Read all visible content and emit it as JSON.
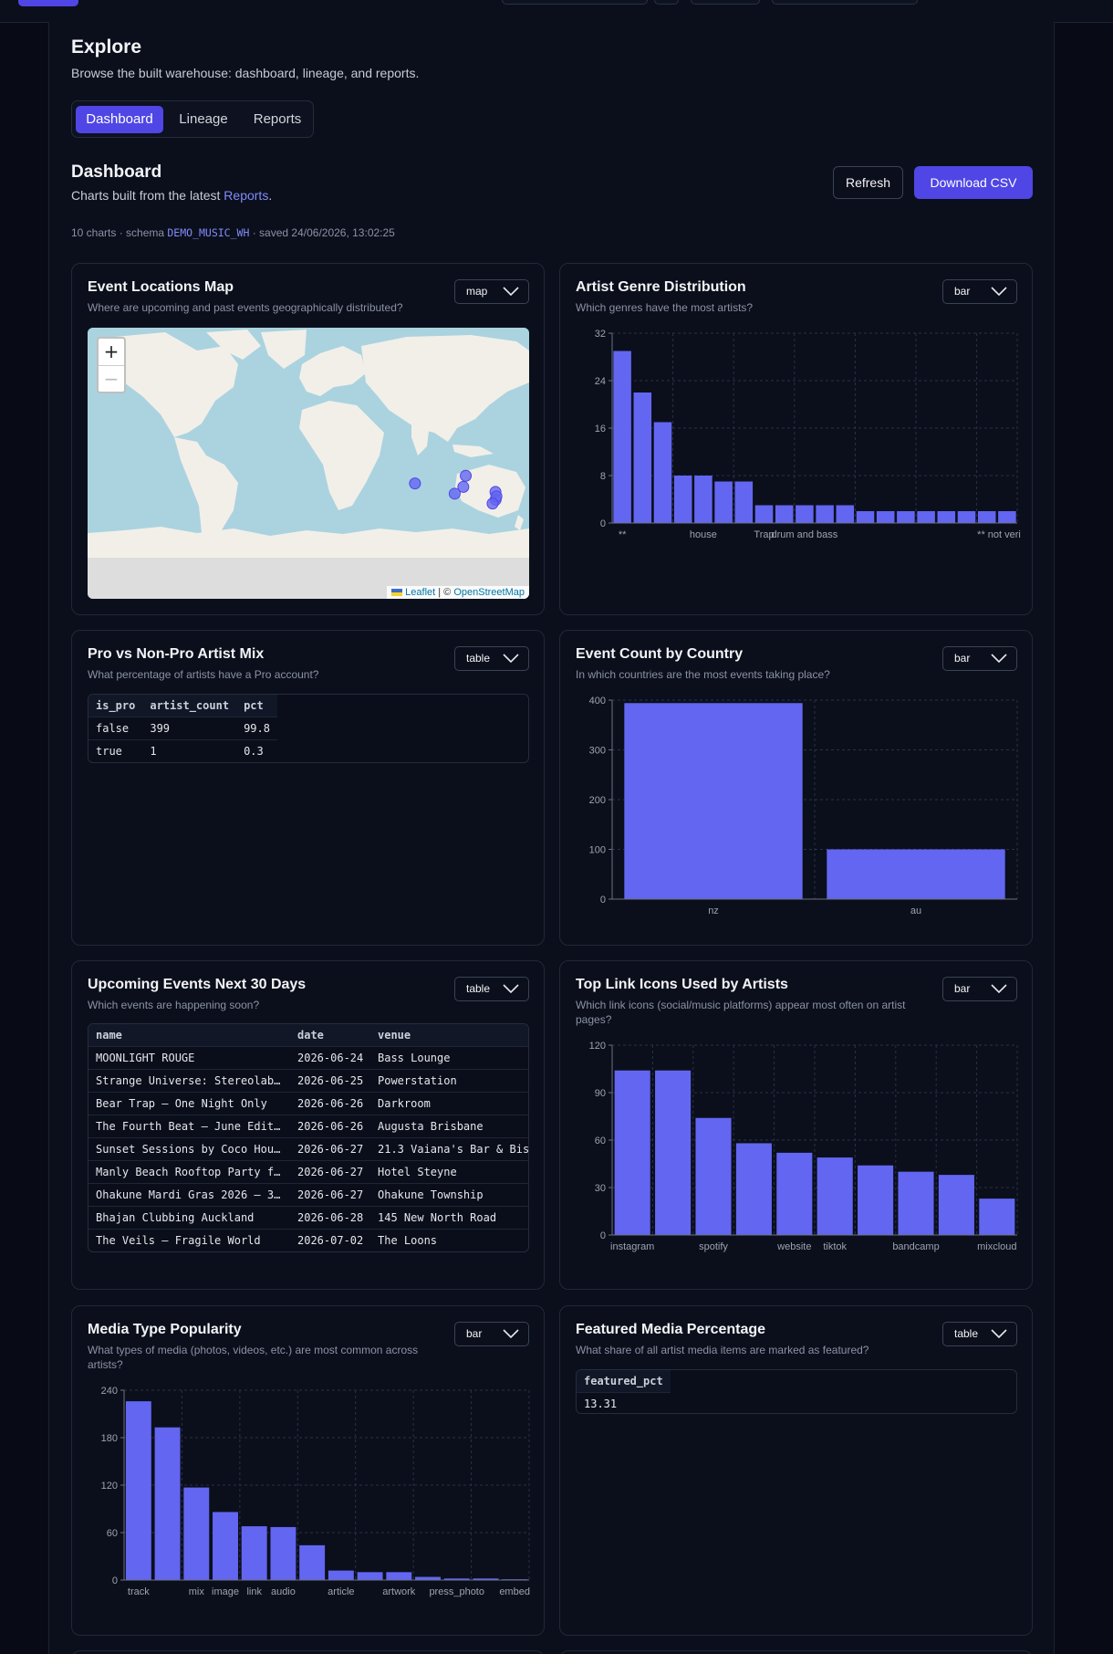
{
  "page": {
    "title": "Explore",
    "subtitle": "Browse the built warehouse: dashboard, lineage, and reports.",
    "tabs": [
      "Dashboard",
      "Lineage",
      "Reports"
    ],
    "active_tab": "Dashboard"
  },
  "dashboard": {
    "title": "Dashboard",
    "subtitle_prefix": "Charts built from the latest ",
    "subtitle_link": "Reports",
    "subtitle_suffix": ".",
    "refresh_label": "Refresh",
    "download_label": "Download CSV",
    "meta_prefix": "10 charts · schema ",
    "schema": "DEMO_MUSIC_WH",
    "meta_suffix": " · saved 24/06/2026, 13:02:25"
  },
  "cards": {
    "map": {
      "title": "Event Locations Map",
      "question": "Where are upcoming and past events geographically distributed?",
      "view": "map",
      "zoom_in": "+",
      "zoom_out": "−",
      "attribution_leaflet": "Leaflet",
      "attribution_sep": " | © ",
      "attribution_osm": "OpenStreetMap",
      "points": [
        {
          "lat": -17.5,
          "lng": -149.5
        },
        {
          "lat": -27.5,
          "lng": 153.0
        },
        {
          "lat": -33.9,
          "lng": 151.2
        },
        {
          "lat": -37.8,
          "lng": 144.9
        },
        {
          "lat": -36.8,
          "lng": 174.7
        },
        {
          "lat": -41.3,
          "lng": 174.8
        },
        {
          "lat": -39.4,
          "lng": 175.4
        },
        {
          "lat": -43.5,
          "lng": 172.6
        },
        {
          "lat": -31.9,
          "lng": 115.9
        }
      ]
    },
    "genre": {
      "title": "Artist Genre Distribution",
      "question": "Which genres have the most artists?",
      "view": "bar"
    },
    "pro": {
      "title": "Pro vs Non-Pro Artist Mix",
      "question": "What percentage of artists have a Pro account?",
      "view": "table",
      "columns": [
        "is_pro",
        "artist_count",
        "pct"
      ],
      "rows": [
        [
          "false",
          "399",
          "99.8"
        ],
        [
          "true",
          "1",
          "0.3"
        ]
      ]
    },
    "country": {
      "title": "Event Count by Country",
      "question": "In which countries are the most events taking place?",
      "view": "bar"
    },
    "upcoming": {
      "title": "Upcoming Events Next 30 Days",
      "question": "Which events are happening soon?",
      "view": "table",
      "columns": [
        "name",
        "date",
        "venue"
      ],
      "rows": [
        [
          "MOONLIGHT ROUGE",
          "2026-06-24",
          "Bass Lounge"
        ],
        [
          "Strange Universe: Stereolab…",
          "2026-06-25",
          "Powerstation"
        ],
        [
          "Bear Trap – One Night Only",
          "2026-06-26",
          "Darkroom"
        ],
        [
          "The Fourth Beat – June Edit…",
          "2026-06-26",
          "Augusta Brisbane"
        ],
        [
          "Sunset Sessions by Coco Hou…",
          "2026-06-27",
          "21.3 Vaiana's Bar & Bis"
        ],
        [
          "Manly Beach Rooftop Party f…",
          "2026-06-27",
          "Hotel Steyne"
        ],
        [
          "Ohakune Mardi Gras 2026 – 3…",
          "2026-06-27",
          "Ohakune Township"
        ],
        [
          "Bhajan Clubbing Auckland",
          "2026-06-28",
          "145 New North Road"
        ],
        [
          "The Veils – Fragile World",
          "2026-07-02",
          "The Loons"
        ]
      ]
    },
    "links": {
      "title": "Top Link Icons Used by Artists",
      "question": "Which link icons (social/music platforms) appear most often on artist pages?",
      "view": "bar"
    },
    "media": {
      "title": "Media Type Popularity",
      "question": "What types of media (photos, videos, etc.) are most common across artists?",
      "view": "bar"
    },
    "featured": {
      "title": "Featured Media Percentage",
      "question": "What share of all artist media items are marked as featured?",
      "view": "table",
      "columns": [
        "featured_pct"
      ],
      "rows": [
        [
          "13.31"
        ]
      ]
    }
  },
  "chart_data": [
    {
      "id": "genre",
      "type": "bar",
      "categories": [
        "**",
        "",
        "",
        "",
        "house",
        "",
        "",
        "Trap",
        "",
        "drum and bass",
        "",
        "",
        "",
        "",
        "",
        "",
        "",
        "",
        "",
        "** not verified"
      ],
      "values": [
        29,
        22,
        17,
        8,
        8,
        7,
        7,
        3,
        3,
        3,
        3,
        3,
        2,
        2,
        2,
        2,
        2,
        2,
        2,
        2
      ],
      "ylim": [
        0,
        32
      ],
      "yticks": [
        0,
        8,
        16,
        24,
        32
      ],
      "grid": true,
      "color": "#6366f1"
    },
    {
      "id": "country",
      "type": "bar",
      "categories": [
        "nz",
        "au"
      ],
      "values": [
        394,
        100
      ],
      "ylim": [
        0,
        400
      ],
      "yticks": [
        0,
        100,
        200,
        300,
        400
      ],
      "grid": true,
      "color": "#6366f1"
    },
    {
      "id": "links",
      "type": "bar",
      "categories": [
        "instagram",
        "",
        "spotify",
        "",
        "website",
        "tiktok",
        "",
        "bandcamp",
        "",
        "mixcloud"
      ],
      "values": [
        104,
        104,
        74,
        58,
        52,
        49,
        44,
        40,
        38,
        23
      ],
      "ylim": [
        0,
        120
      ],
      "yticks": [
        0,
        30,
        60,
        90,
        120
      ],
      "grid": true,
      "color": "#6366f1"
    },
    {
      "id": "media",
      "type": "bar",
      "categories": [
        "track",
        "",
        "mix",
        "image",
        "link",
        "audio",
        "",
        "article",
        "",
        "artwork",
        "",
        "press_photo",
        "",
        "embed"
      ],
      "values": [
        226,
        193,
        117,
        86,
        68,
        67,
        44,
        12,
        10,
        10,
        4,
        2,
        2,
        1
      ],
      "ylim": [
        0,
        240
      ],
      "yticks": [
        0,
        60,
        120,
        180,
        240
      ],
      "grid": true,
      "color": "#6366f1"
    }
  ],
  "colors": {
    "accent": "#4f46e5",
    "bar": "#6366f1",
    "link": "#818cf8",
    "map_water": "#aad3df",
    "map_land": "#f2efe9"
  }
}
